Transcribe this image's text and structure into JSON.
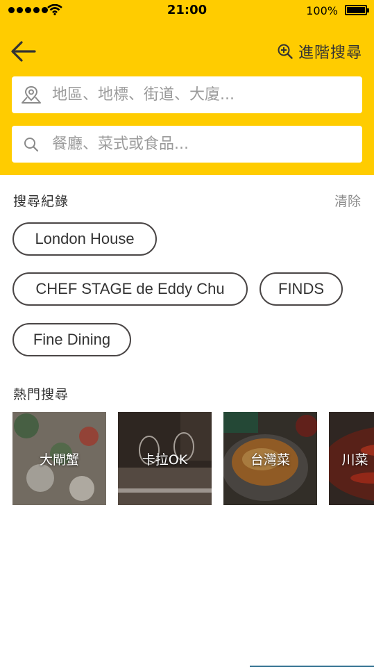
{
  "status_bar": {
    "time": "21:00",
    "battery": "100%"
  },
  "header": {
    "back_icon": "arrow-left-icon",
    "advanced_search_label": "進階搜尋",
    "advanced_search_icon": "zoom-in-icon",
    "location_placeholder": "地區、地標、街道、大廈...",
    "location_icon": "map-pin-icon",
    "food_placeholder": "餐廳、菜式或食品...",
    "food_icon": "search-icon",
    "background_color": "#FFCC00"
  },
  "history": {
    "title": "搜尋紀錄",
    "clear_label": "清除",
    "items": [
      "London House",
      "CHEF STAGE de Eddy Chu",
      "FINDS",
      "Fine Dining"
    ]
  },
  "popular": {
    "title": "熱門搜尋",
    "items": [
      {
        "label": "大閘蟹"
      },
      {
        "label": "卡拉OK"
      },
      {
        "label": "台灣菜"
      },
      {
        "label": "川菜"
      }
    ]
  }
}
